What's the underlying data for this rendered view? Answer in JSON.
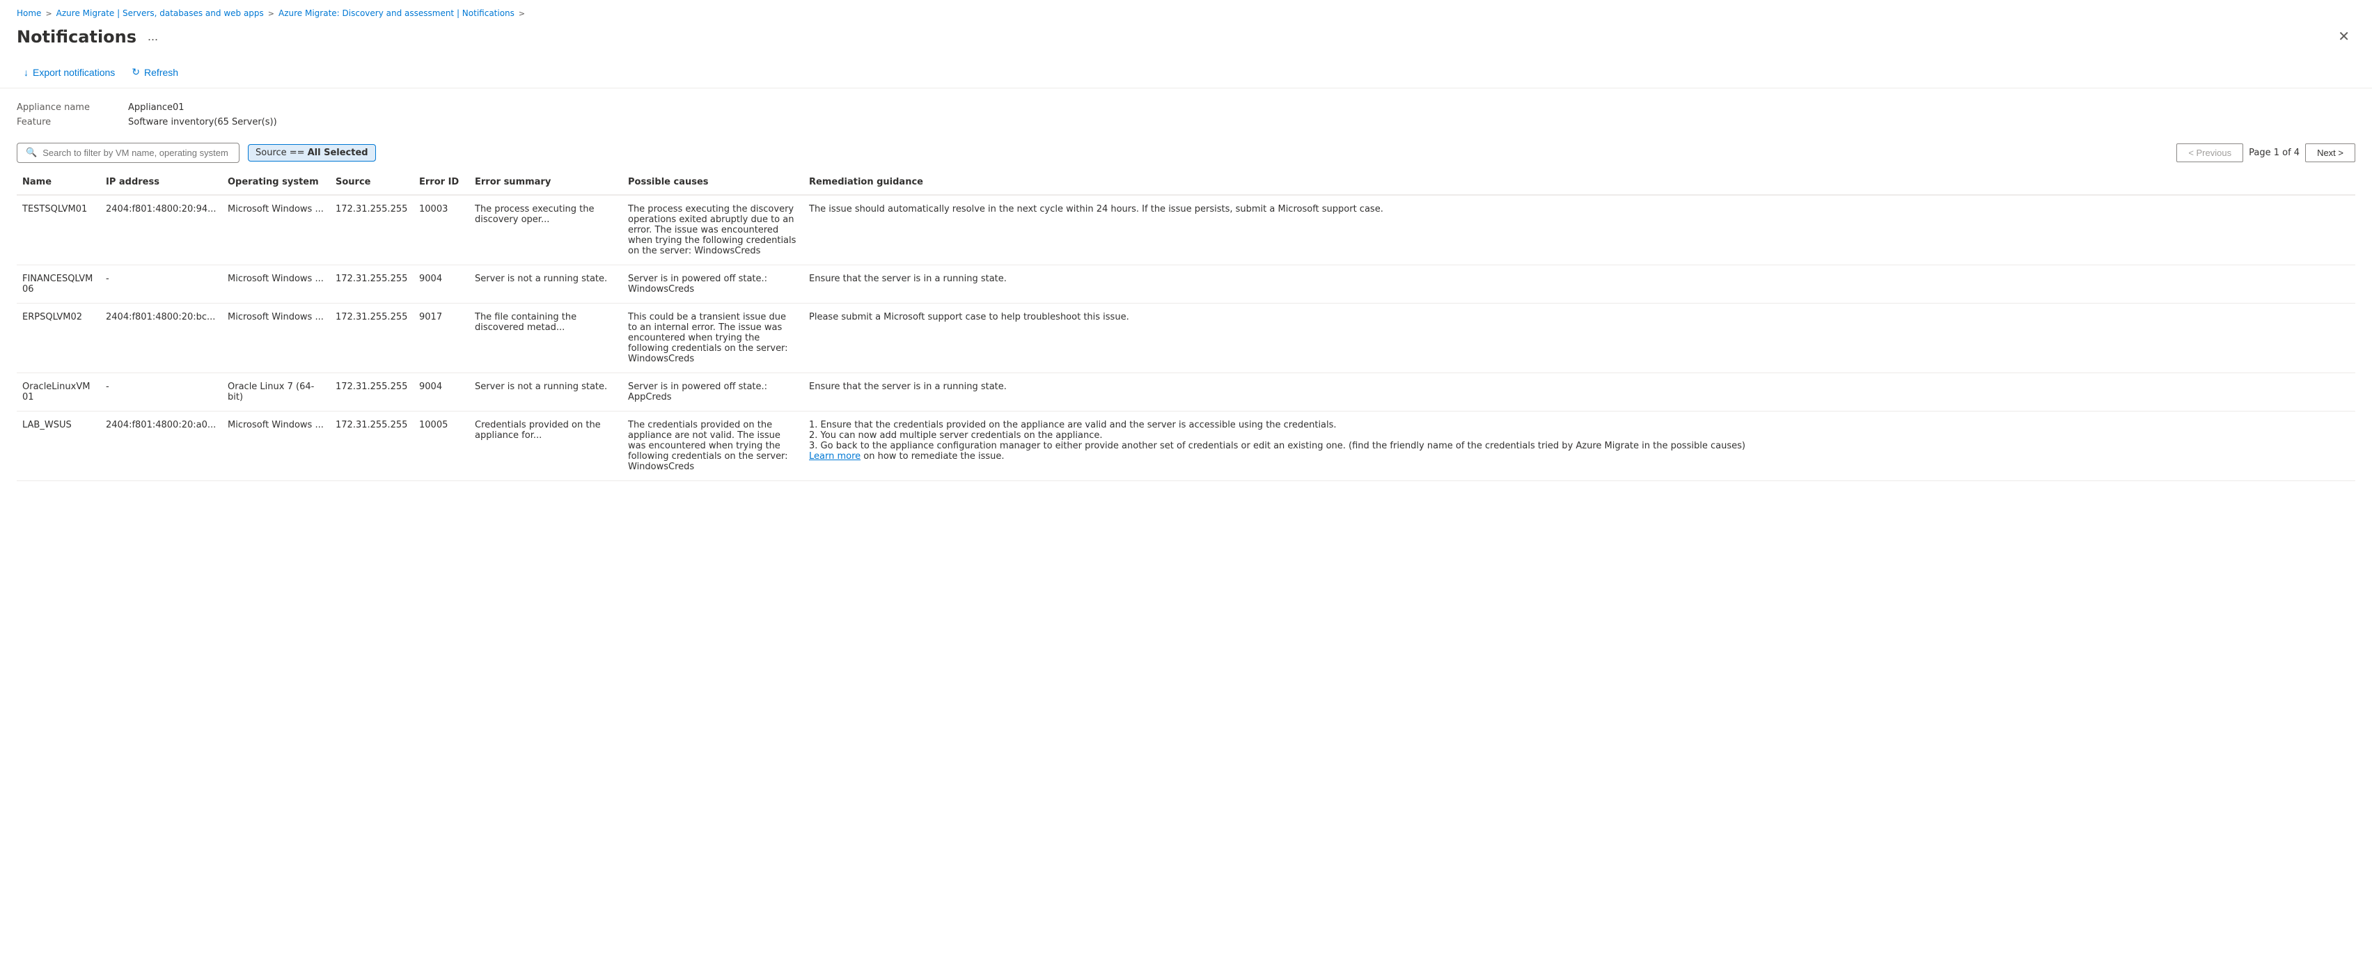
{
  "breadcrumb": {
    "items": [
      {
        "label": "Home",
        "link": true
      },
      {
        "label": "Azure Migrate | Servers, databases and web apps",
        "link": true
      },
      {
        "label": "Azure Migrate: Discovery and assessment | Notifications",
        "link": true
      }
    ],
    "separator": ">"
  },
  "page": {
    "title": "Notifications",
    "ellipsis_label": "...",
    "close_label": "✕"
  },
  "toolbar": {
    "export_label": "Export notifications",
    "refresh_label": "Refresh"
  },
  "info": {
    "appliance_name_label": "Appliance name",
    "appliance_name_value": "Appliance01",
    "feature_label": "Feature",
    "feature_value": "Software inventory(65 Server(s))"
  },
  "filter": {
    "search_placeholder": "Search to filter by VM name, operating system and error ID",
    "source_label": "Source ==",
    "source_value": "All Selected"
  },
  "pagination": {
    "previous_label": "< Previous",
    "next_label": "Next >",
    "page_info": "Page 1 of 4"
  },
  "table": {
    "columns": [
      {
        "key": "name",
        "label": "Name"
      },
      {
        "key": "ip_address",
        "label": "IP address"
      },
      {
        "key": "operating_system",
        "label": "Operating system"
      },
      {
        "key": "source",
        "label": "Source"
      },
      {
        "key": "error_id",
        "label": "Error ID"
      },
      {
        "key": "error_summary",
        "label": "Error summary"
      },
      {
        "key": "possible_causes",
        "label": "Possible causes"
      },
      {
        "key": "remediation_guidance",
        "label": "Remediation guidance"
      }
    ],
    "rows": [
      {
        "name": "TESTSQLVM01",
        "ip_address": "2404:f801:4800:20:94...",
        "operating_system": "Microsoft Windows ...",
        "source": "172.31.255.255",
        "error_id": "10003",
        "error_summary": "The process executing the discovery oper...",
        "possible_causes": "The process executing the discovery operations exited abruptly due to an error. The issue was encountered when trying the following credentials on the server: WindowsCreds",
        "remediation_guidance": "The issue should automatically resolve in the next cycle within 24 hours. If the issue persists, submit a Microsoft support case.",
        "has_link": false
      },
      {
        "name": "FINANCESQLVM06",
        "ip_address": "-",
        "operating_system": "Microsoft Windows ...",
        "source": "172.31.255.255",
        "error_id": "9004",
        "error_summary": "Server is not a running state.",
        "possible_causes": "Server is in powered off state.: WindowsCreds",
        "remediation_guidance": "Ensure that the server is in a running state.",
        "has_link": false
      },
      {
        "name": "ERPSQLVM02",
        "ip_address": "2404:f801:4800:20:bc...",
        "operating_system": "Microsoft Windows ...",
        "source": "172.31.255.255",
        "error_id": "9017",
        "error_summary": "The file containing the discovered metad...",
        "possible_causes": "This could be a transient issue due to an internal error. The issue was encountered when trying the following credentials on the server: WindowsCreds",
        "remediation_guidance": "Please submit a Microsoft support case to help troubleshoot this issue.",
        "has_link": false
      },
      {
        "name": "OracleLinuxVM01",
        "ip_address": "-",
        "operating_system": "Oracle Linux 7 (64-bit)",
        "source": "172.31.255.255",
        "error_id": "9004",
        "error_summary": "Server is not a running state.",
        "possible_causes": "Server is in powered off state.: AppCreds",
        "remediation_guidance": "Ensure that the server is in a running state.",
        "has_link": false
      },
      {
        "name": "LAB_WSUS",
        "ip_address": "2404:f801:4800:20:a0...",
        "operating_system": "Microsoft Windows ...",
        "source": "172.31.255.255",
        "error_id": "10005",
        "error_summary": "Credentials provided on the appliance for...",
        "possible_causes": "The credentials provided on the appliance are not valid. The issue was encountered when trying the following credentials on the server: WindowsCreds",
        "remediation_guidance": "1. Ensure that the credentials provided on the appliance are valid and the server is accessible using the credentials.\n2. You can now add multiple server credentials on the appliance.\n3. Go back to the appliance configuration manager to either provide another set of credentials or edit an existing one. (find the friendly name of the credentials tried by Azure Migrate in the possible causes)",
        "remediation_link_text": "Learn more",
        "remediation_link_suffix": " on how to remediate the issue.",
        "has_link": true
      }
    ]
  }
}
